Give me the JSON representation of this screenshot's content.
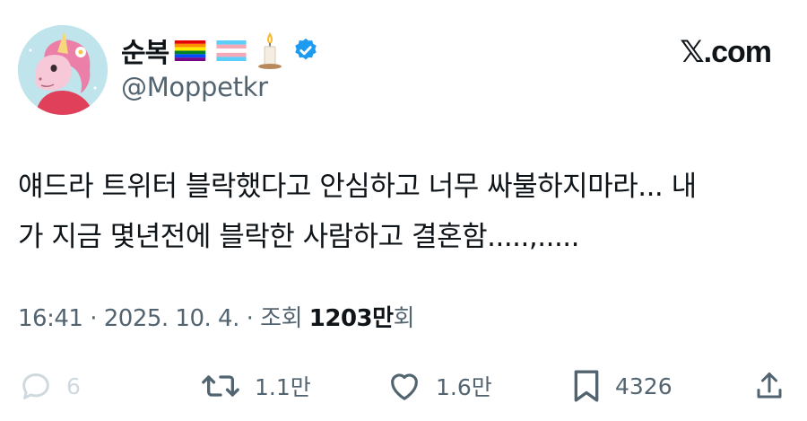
{
  "header": {
    "display_name": "순복",
    "handle": "@Moppetkr",
    "brand": "𝕏.com",
    "verified_color": "#1d9bf0"
  },
  "icons": [
    "rainbow-flag-emoji",
    "transgender-flag-emoji",
    "candle-emoji",
    "verified-badge-icon"
  ],
  "tweet": {
    "text": "얘드라 트위터 블락했다고 안심하고 너무 싸불하지마라... 내\n가 지금 몇년전에 블락한 사람하고 결혼함.....,....."
  },
  "meta": {
    "time": "16:41",
    "date": "2025. 10. 4.",
    "views_prefix": "조회",
    "views": "1203만",
    "views_suffix": "회",
    "separator": "·"
  },
  "actions": {
    "reply_count": "6",
    "retweet_count": "1.1만",
    "like_count": "1.6만",
    "bookmark_count": "4326"
  }
}
